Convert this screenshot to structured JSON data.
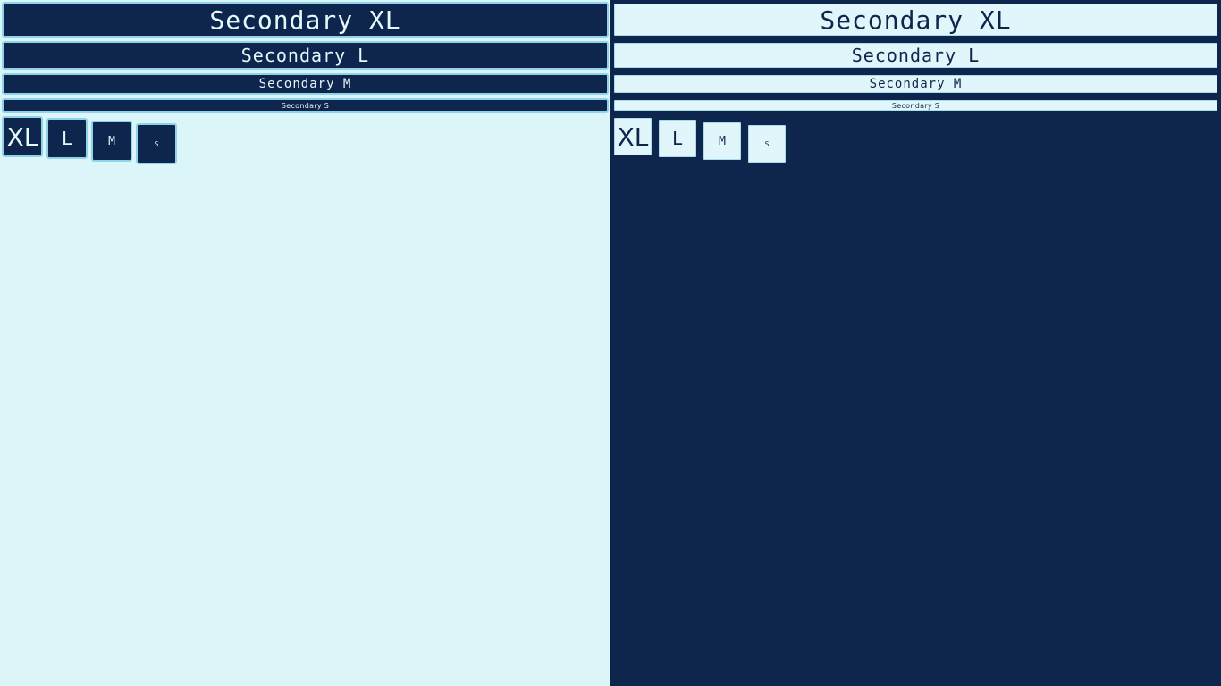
{
  "colors": {
    "navy": "#0e264e",
    "light_cyan": "#dcf5f9",
    "border_blue": "#8fd3e8"
  },
  "left_panel": {
    "wide_buttons": {
      "xl": "Secondary XL",
      "l": "Secondary L",
      "m": "Secondary M",
      "s": "Secondary S"
    },
    "square_buttons": {
      "xl": "XL",
      "l": "L",
      "m": "M",
      "s": "S"
    }
  },
  "right_panel": {
    "wide_buttons": {
      "xl": "Secondary XL",
      "l": "Secondary L",
      "m": "Secondary M",
      "s": "Secondary S"
    },
    "square_buttons": {
      "xl": "XL",
      "l": "L",
      "m": "M",
      "s": "S"
    }
  }
}
